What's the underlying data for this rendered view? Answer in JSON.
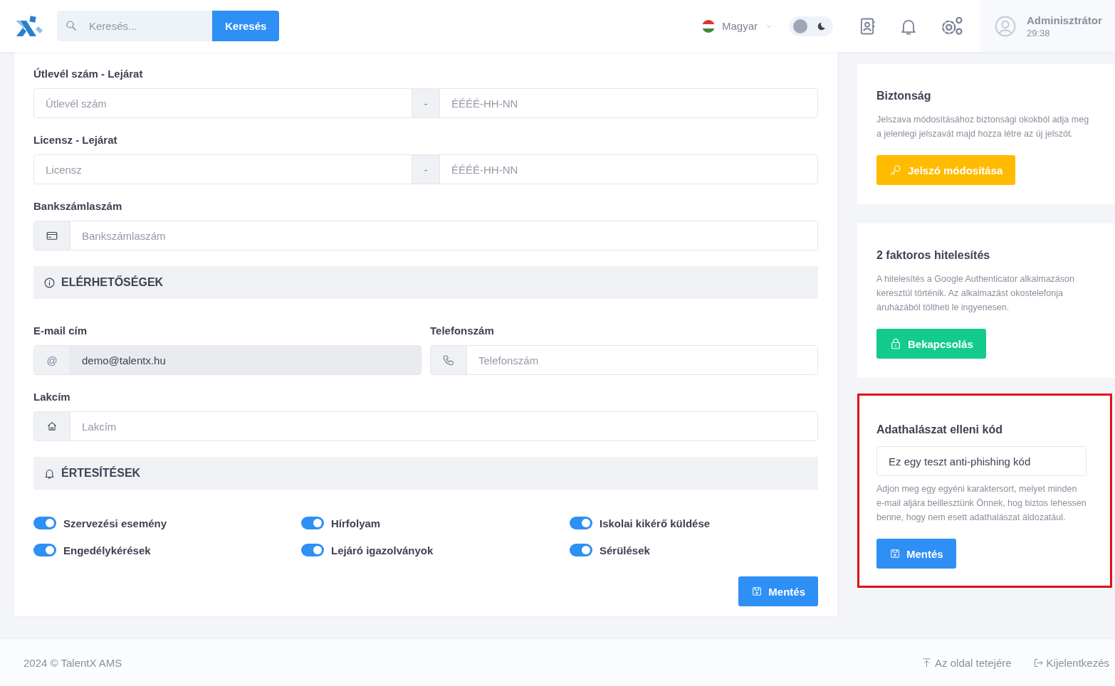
{
  "header": {
    "search": {
      "placeholder": "Keresés...",
      "button": "Keresés"
    },
    "language": "Magyar",
    "dark_mode": {
      "on": false
    },
    "user": {
      "name": "Adminisztrátor",
      "timer": "29:38"
    }
  },
  "profile_form": {
    "passport": {
      "label": "Útlevél szám - Lejárat",
      "number_placeholder": "Útlevél szám",
      "separator": "-",
      "expiry_placeholder": "ÉÉÉÉ-HH-NN"
    },
    "license": {
      "label": "Licensz - Lejárat",
      "number_placeholder": "Licensz",
      "separator": "-",
      "expiry_placeholder": "ÉÉÉÉ-HH-NN"
    },
    "bank_account": {
      "label": "Bankszámlaszám",
      "placeholder": "Bankszámlaszám"
    },
    "contacts_section": {
      "title": "ELÉRHETŐSÉGEK"
    },
    "email": {
      "label": "E-mail cím",
      "prefix": "@",
      "value": "demo@talentx.hu",
      "disabled": true
    },
    "phone": {
      "label": "Telefonszám",
      "placeholder": "Telefonszám"
    },
    "address": {
      "label": "Lakcím",
      "placeholder": "Lakcím"
    },
    "notifications_section": {
      "title": "ÉRTESÍTÉSEK"
    },
    "notifications": [
      {
        "label": "Szervezési esemény",
        "on": true
      },
      {
        "label": "Hírfolyam",
        "on": true
      },
      {
        "label": "Iskolai kikérő küldése",
        "on": true
      },
      {
        "label": "Engedélykérések",
        "on": true
      },
      {
        "label": "Lejáró igazolványok",
        "on": true
      },
      {
        "label": "Sérülések",
        "on": true
      }
    ],
    "save_button": "Mentés"
  },
  "security": {
    "title": "Biztonság",
    "text": "Jelszava módosításához biztonsági okokból adja meg a jelenlegi jelszavát majd hozza létre az új jelszót.",
    "button": "Jelszó módosítása"
  },
  "two_factor": {
    "title": "2 faktoros hitelesítés",
    "text": "A hitelesítés a Google Authenticator alkalmazáson keresztül történik. Az alkalmazást okostelefonja áruházából töltheti le ingyenesen.",
    "button": "Bekapcsolás"
  },
  "anti_phishing": {
    "title": "Adathalászat elleni kód",
    "value": "Ez egy teszt anti-phishing kód",
    "help": "Adjon meg egy egyéni karaktersort, melyet minden e-mail aljára beillesztünk Önnek, hog biztos lehessen benne, hogy nem esett adathalászat áldozatául.",
    "button": "Mentés",
    "highlighted": true
  },
  "footer": {
    "copyright": "2024 © TalentX AMS",
    "links": [
      "Az oldal tetejére",
      "Kijelentkezés"
    ]
  }
}
